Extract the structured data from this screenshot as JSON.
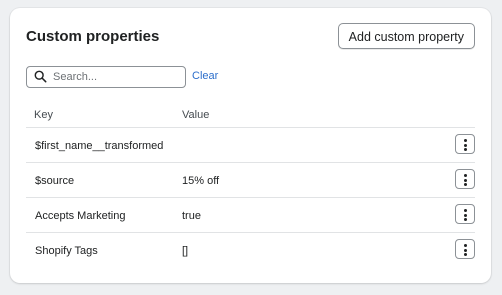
{
  "card": {
    "title": "Custom properties",
    "add_button_label": "Add custom property"
  },
  "search": {
    "placeholder": "Search...",
    "value": "",
    "clear_label": "Clear"
  },
  "table": {
    "columns": [
      "Key",
      "Value"
    ],
    "rows": [
      {
        "key": "$first_name__transformed",
        "value": ""
      },
      {
        "key": "$source",
        "value": "15% off"
      },
      {
        "key": "Accepts Marketing",
        "value": "true"
      },
      {
        "key": "Shopify Tags",
        "value": "[]"
      }
    ]
  },
  "icons": {
    "search": "search-icon",
    "row_actions": "vertical-ellipsis-icon"
  },
  "colors": {
    "link": "#2c6ecb",
    "border": "#8c9196",
    "divider": "#e1e3e5"
  }
}
